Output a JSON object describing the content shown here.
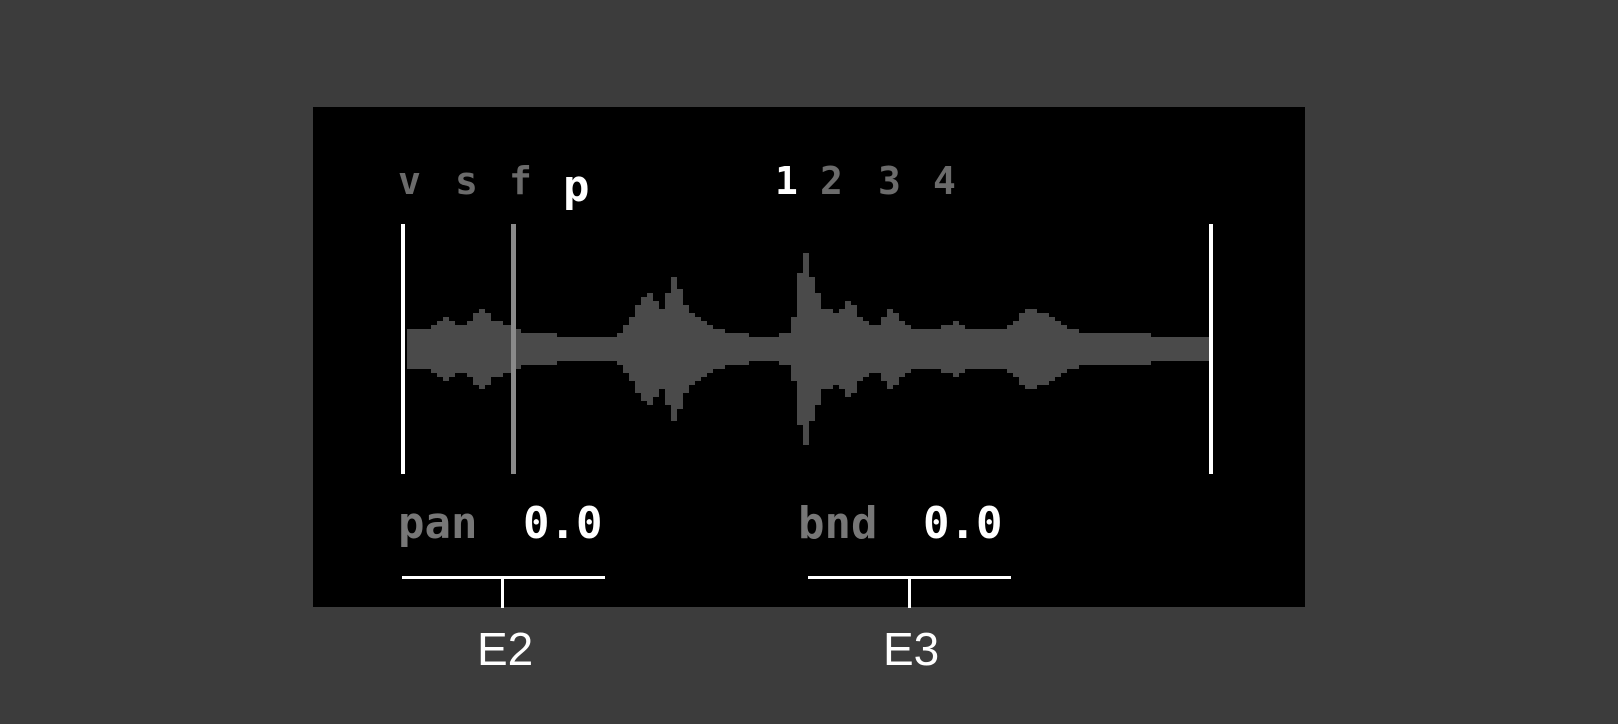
{
  "modes": [
    {
      "label": "v",
      "active": false
    },
    {
      "label": "s",
      "active": false
    },
    {
      "label": "f",
      "active": false
    },
    {
      "label": "p",
      "active": true
    }
  ],
  "tracks": [
    {
      "label": "1",
      "active": true
    },
    {
      "label": "2",
      "active": false
    },
    {
      "label": "3",
      "active": false
    },
    {
      "label": "4",
      "active": false
    }
  ],
  "params": {
    "left": {
      "label": "pan",
      "value": "0.0"
    },
    "right": {
      "label": "bnd",
      "value": "0.0"
    }
  },
  "encoders": {
    "left": "E2",
    "right": "E3"
  },
  "colors": {
    "background": "#3c3c3c",
    "screen": "#000000",
    "waveform": "#4a4a4a",
    "marker": "#ffffff",
    "playhead": "#8a8a8a",
    "inactive_text": "#6b6b6b",
    "active_text": "#ffffff"
  },
  "playhead_position": 0.13
}
